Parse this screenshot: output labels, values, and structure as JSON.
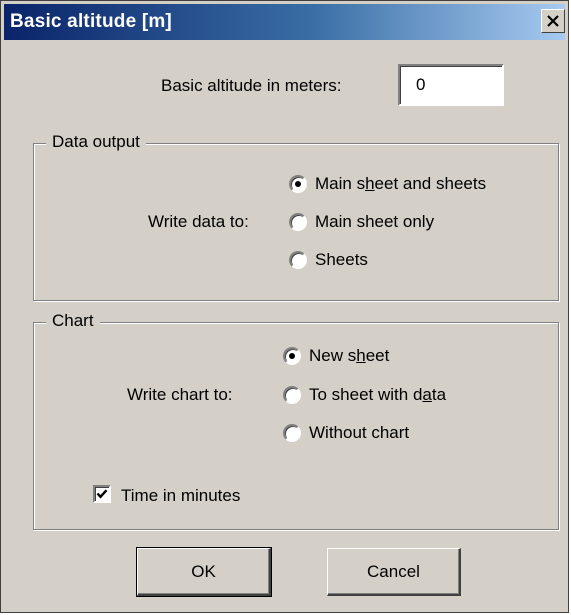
{
  "window": {
    "title": "Basic altitude [m]"
  },
  "altitude": {
    "label": "Basic altitude in meters:",
    "value": "0"
  },
  "data_output": {
    "legend": "Data output",
    "label": "Write data to:",
    "options": [
      {
        "pre": "Main s",
        "accel": "h",
        "post": "eet and sheets",
        "selected": true
      },
      {
        "pre": "Main sheet only",
        "accel": "",
        "post": "",
        "selected": false
      },
      {
        "pre": "Sheets",
        "accel": "",
        "post": "",
        "selected": false
      }
    ]
  },
  "chart": {
    "legend": "Chart",
    "label": "Write chart to:",
    "options": [
      {
        "pre": "New s",
        "accel": "h",
        "post": "eet",
        "selected": true
      },
      {
        "pre": "To sheet with d",
        "accel": "a",
        "post": "ta",
        "selected": false
      },
      {
        "pre": "Without chart",
        "accel": "",
        "post": "",
        "selected": false
      }
    ],
    "time_in_minutes": {
      "label": "Time in minutes",
      "checked": true
    }
  },
  "buttons": {
    "ok": "OK",
    "cancel": "Cancel"
  },
  "icons": {
    "close": "close-icon",
    "check": "checkmark-icon"
  }
}
